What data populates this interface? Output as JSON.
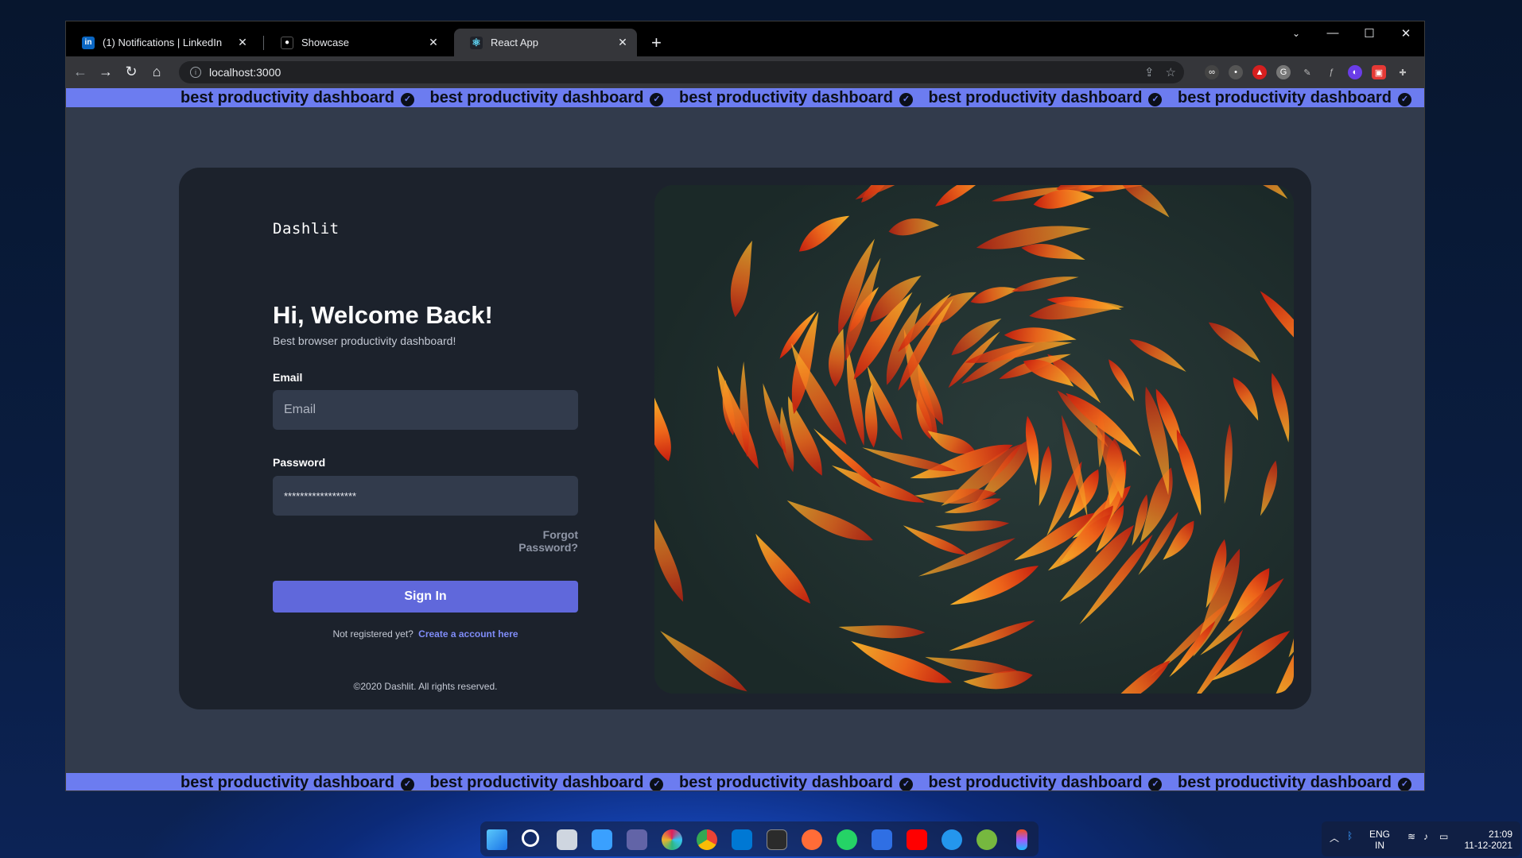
{
  "browser": {
    "tabs": [
      {
        "title": "(1) Notifications | LinkedIn",
        "favicon": "linkedin-icon"
      },
      {
        "title": "Showcase",
        "favicon": "showcase-icon"
      },
      {
        "title": "React App",
        "favicon": "react-icon"
      }
    ],
    "url": "localhost:3000"
  },
  "marquee": {
    "text": "best productivity dashboard",
    "accent": "#6c7cf0"
  },
  "login": {
    "brand": "Dashlit",
    "heading": "Hi, Welcome Back!",
    "subheading": "Best browser productivity dashboard!",
    "email_label": "Email",
    "email_placeholder": "Email",
    "password_label": "Password",
    "password_value": "******************",
    "forgot": "Forgot Password?",
    "signin": "Sign In",
    "register_prompt": "Not registered yet?",
    "register_link": "Create a account here",
    "copyright": "©2020 Dashlit. All rights reserved."
  },
  "system": {
    "lang": "ENG",
    "region": "IN",
    "time": "21:09",
    "date": "11-12-2021"
  }
}
